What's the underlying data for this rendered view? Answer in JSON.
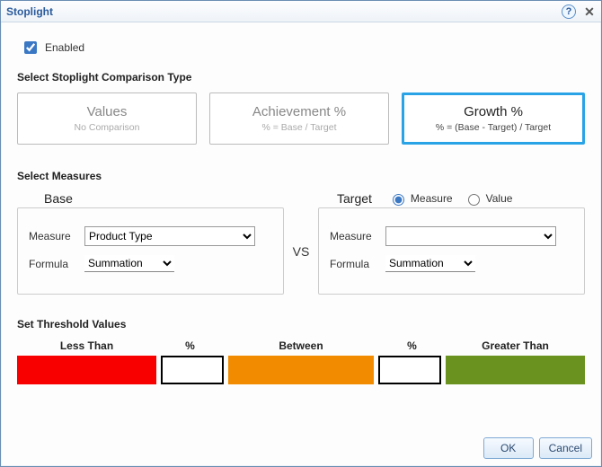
{
  "window": {
    "title": "Stoplight"
  },
  "enabled": {
    "label": "Enabled",
    "checked": true
  },
  "comparison": {
    "header": "Select Stoplight Comparison Type",
    "options": [
      {
        "title": "Values",
        "sub": "No Comparison",
        "selected": false
      },
      {
        "title": "Achievement %",
        "sub": "% = Base / Target",
        "selected": false
      },
      {
        "title": "Growth %",
        "sub": "% = (Base - Target) / Target",
        "selected": true
      }
    ]
  },
  "measures": {
    "header": "Select Measures",
    "vs": "VS",
    "base": {
      "title": "Base",
      "measure_label": "Measure",
      "measure_value": "Product Type",
      "formula_label": "Formula",
      "formula_value": "Summation"
    },
    "target": {
      "title": "Target",
      "mode_measure_label": "Measure",
      "mode_value_label": "Value",
      "mode": "measure",
      "measure_label": "Measure",
      "measure_value": "",
      "formula_label": "Formula",
      "formula_value": "Summation"
    }
  },
  "thresholds": {
    "header": "Set Threshold Values",
    "less_label": "Less Than",
    "pct_label": "%",
    "between_label": "Between",
    "greater_label": "Greater Than",
    "pct1_value": "",
    "pct2_value": "",
    "colors": {
      "less": "#f90000",
      "between": "#f28b00",
      "greater": "#69931e"
    }
  },
  "buttons": {
    "ok": "OK",
    "cancel": "Cancel"
  }
}
